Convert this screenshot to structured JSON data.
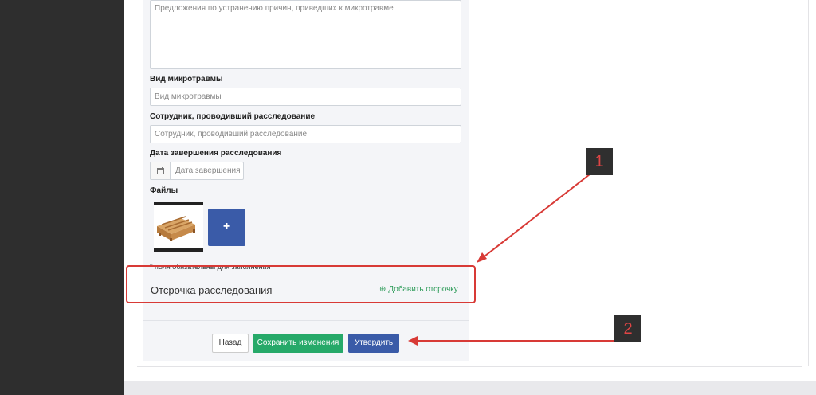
{
  "form": {
    "proposals_placeholder": "Предложения по устранению причин, приведших к микротравме",
    "injury_type": {
      "label": "Вид микротравмы",
      "placeholder": "Вид микротравмы"
    },
    "investigator": {
      "label": "Сотрудник, проводивший расследование",
      "placeholder": "Сотрудник, проводивший расследование"
    },
    "completion_date": {
      "label": "Дата завершения расследования",
      "placeholder": "Дата завершения"
    },
    "files": {
      "label": "Файлы",
      "add_symbol": "+"
    },
    "required_note": "* поля обязательны для заполнения"
  },
  "delay_section": {
    "title": "Отсрочка расследования",
    "add_icon": "⊕",
    "add_label": "Добавить отсрочку"
  },
  "buttons": {
    "back": "Назад",
    "save": "Сохранить изменения",
    "approve": "Утвердить"
  },
  "annotations": [
    {
      "number": "1",
      "color": "#e04545"
    },
    {
      "number": "2",
      "color": "#e04545"
    }
  ]
}
